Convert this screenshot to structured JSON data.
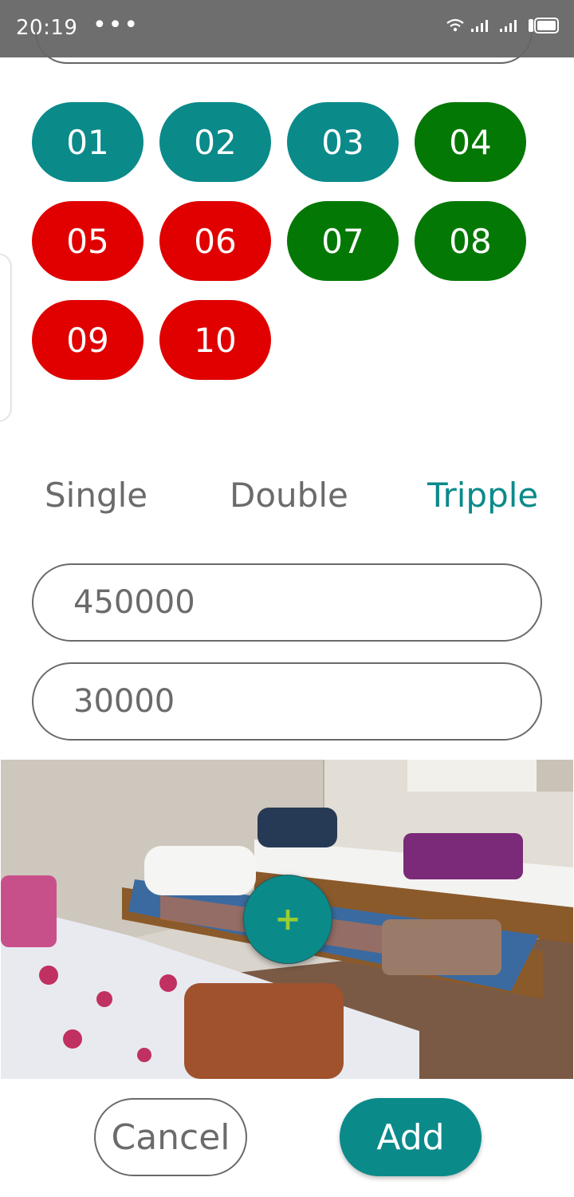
{
  "status_bar": {
    "time": "20:19",
    "dots": "•••"
  },
  "rooms": [
    {
      "number": "01",
      "status": "teal"
    },
    {
      "number": "02",
      "status": "teal"
    },
    {
      "number": "03",
      "status": "teal"
    },
    {
      "number": "04",
      "status": "green"
    },
    {
      "number": "05",
      "status": "red"
    },
    {
      "number": "06",
      "status": "red"
    },
    {
      "number": "07",
      "status": "green"
    },
    {
      "number": "08",
      "status": "green"
    },
    {
      "number": "09",
      "status": "red"
    },
    {
      "number": "10",
      "status": "red"
    }
  ],
  "colors": {
    "teal": "#0b8a8a",
    "green": "#047804",
    "red": "#e00000",
    "accent": "#0b8a8a"
  },
  "room_types": {
    "single": "Single",
    "double": "Double",
    "triple": "Tripple",
    "selected": "Tripple"
  },
  "fields": {
    "price": "450000",
    "deposit": "30000"
  },
  "photo": {
    "add_icon": "+"
  },
  "actions": {
    "cancel": "Cancel",
    "add": "Add"
  }
}
